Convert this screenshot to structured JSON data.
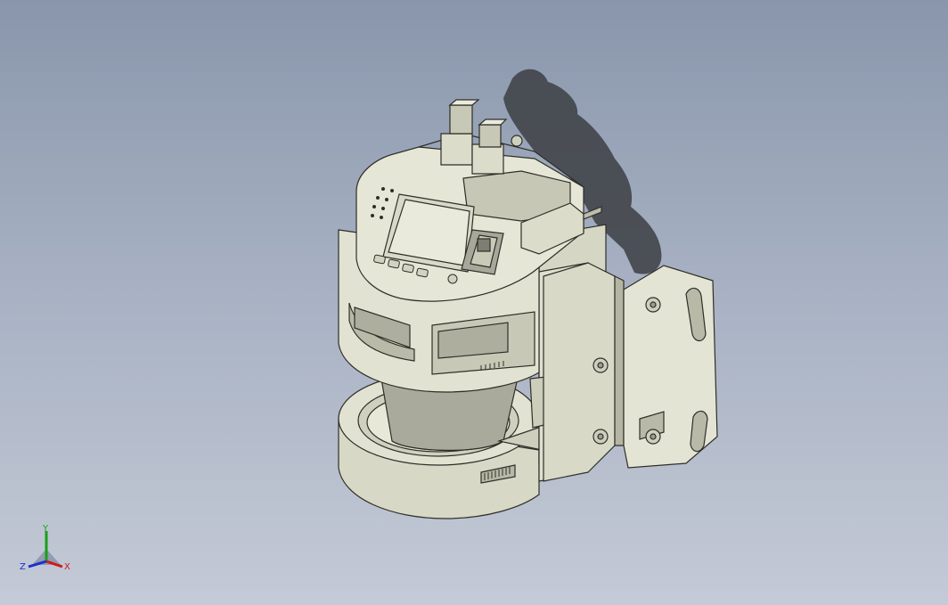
{
  "viewport": {
    "background_top": "#8996ab",
    "background_bottom": "#c4cad6",
    "part_color": "#e2e2d2",
    "part_shade": "#c9c9b6",
    "edge_color": "#2e2e28",
    "shadow_color": "#3c3e43"
  },
  "triad": {
    "x_label": "X",
    "y_label": "Y",
    "z_label": "Z",
    "x_color": "#d01a1a",
    "y_color": "#18a018",
    "z_color": "#1a30d0"
  }
}
